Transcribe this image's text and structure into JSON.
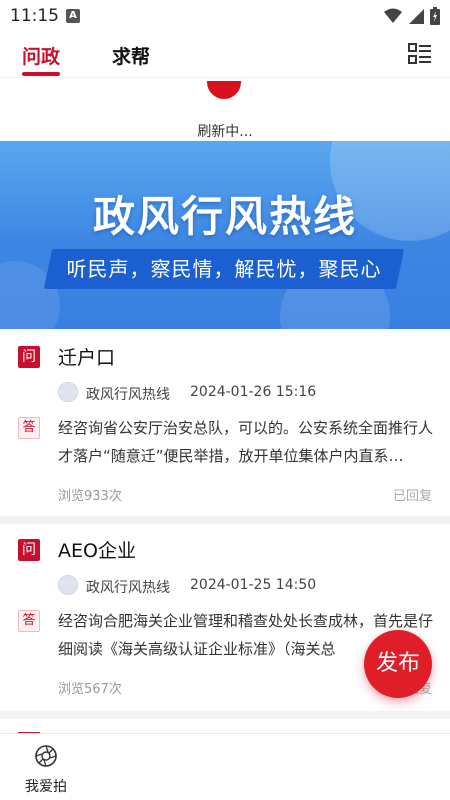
{
  "status_bar": {
    "time": "11:15",
    "notif_letter": "A",
    "icons": [
      "wifi-icon",
      "signal-icon",
      "battery-icon"
    ]
  },
  "header": {
    "tabs": [
      {
        "label": "问政",
        "active": true
      },
      {
        "label": "求帮",
        "active": false
      }
    ],
    "menu_icon": "grid-list-icon"
  },
  "refresh": {
    "text": "刷新中..."
  },
  "banner": {
    "title": "政风行风热线",
    "slogan": "听民声，察民情，解民忧，聚民心"
  },
  "posts": [
    {
      "question_badge": "问",
      "title": "迁户口",
      "source": "政风行风热线",
      "date": "2024-01-26 15:16",
      "answer_badge": "答",
      "answer": "经咨询省公安厅治安总队，可以的。公安系统全面推行人才落户“随意迁”便民举措，放开单位集体户内直系…",
      "views": "浏览933次",
      "status": "已回复"
    },
    {
      "question_badge": "问",
      "title": "AEO企业",
      "source": "政风行风热线",
      "date": "2024-01-25 14:50",
      "answer_badge": "答",
      "answer": "经咨询合肥海关企业管理和稽查处处长查成林，首先是仔细阅读《海关高级认证企业标准》（海关总",
      "views": "浏览567次",
      "status": "已回复"
    }
  ],
  "fab": {
    "label": "发布"
  },
  "bottom_nav": {
    "items": [
      {
        "label": "我爱拍",
        "icon": "camera-shutter-icon"
      }
    ]
  },
  "colors": {
    "brand": "#c8102e",
    "fab": "#e01e2a",
    "banner_blue": "#3c86e3"
  }
}
